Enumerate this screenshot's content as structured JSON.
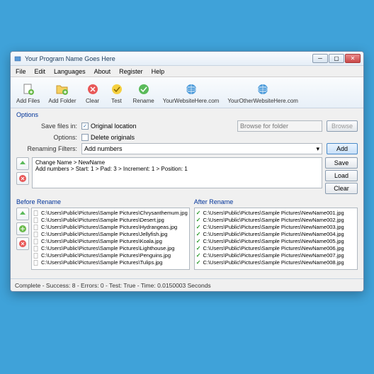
{
  "window": {
    "title": "Your Program Name Goes Here"
  },
  "menu": {
    "items": [
      "File",
      "Edit",
      "Languages",
      "About",
      "Register",
      "Help"
    ]
  },
  "toolbar": {
    "add_files": "Add Files",
    "add_folder": "Add Folder",
    "clear": "Clear",
    "test": "Test",
    "rename": "Rename",
    "website1": "YourWebsiteHere.com",
    "website2": "YourOtherWebsiteHere.com"
  },
  "options": {
    "title": "Options",
    "save_label": "Save files in:",
    "save_checkbox": "Original location",
    "save_checked": true,
    "options_label": "Options:",
    "delete_checkbox": "Delete originals",
    "delete_checked": false,
    "browse_placeholder": "Browse for folder",
    "browse_btn": "Browse",
    "filters_label": "Renaming Filters:",
    "filters_value": "Add numbers",
    "add_btn": "Add"
  },
  "filters": {
    "lines": [
      "Change Name > NewName",
      "Add numbers > Start: 1 > Pad: 3 > Increment: 1 > Position: 1"
    ],
    "save_btn": "Save",
    "load_btn": "Load",
    "clear_btn": "Clear"
  },
  "before": {
    "title": "Before Rename",
    "files": [
      "C:\\Users\\Public\\Pictures\\Sample Pictures\\Chrysanthemum.jpg",
      "C:\\Users\\Public\\Pictures\\Sample Pictures\\Desert.jpg",
      "C:\\Users\\Public\\Pictures\\Sample Pictures\\Hydrangeas.jpg",
      "C:\\Users\\Public\\Pictures\\Sample Pictures\\Jellyfish.jpg",
      "C:\\Users\\Public\\Pictures\\Sample Pictures\\Koala.jpg",
      "C:\\Users\\Public\\Pictures\\Sample Pictures\\Lighthouse.jpg",
      "C:\\Users\\Public\\Pictures\\Sample Pictures\\Penguins.jpg",
      "C:\\Users\\Public\\Pictures\\Sample Pictures\\Tulips.jpg"
    ]
  },
  "after": {
    "title": "After Rename",
    "files": [
      "C:\\Users\\Public\\Pictures\\Sample Pictures\\NewName001.jpg",
      "C:\\Users\\Public\\Pictures\\Sample Pictures\\NewName002.jpg",
      "C:\\Users\\Public\\Pictures\\Sample Pictures\\NewName003.jpg",
      "C:\\Users\\Public\\Pictures\\Sample Pictures\\NewName004.jpg",
      "C:\\Users\\Public\\Pictures\\Sample Pictures\\NewName005.jpg",
      "C:\\Users\\Public\\Pictures\\Sample Pictures\\NewName006.jpg",
      "C:\\Users\\Public\\Pictures\\Sample Pictures\\NewName007.jpg",
      "C:\\Users\\Public\\Pictures\\Sample Pictures\\NewName008.jpg"
    ]
  },
  "status": "Complete - Success: 8 - Errors: 0 - Test: True - Time: 0.0150003 Seconds"
}
